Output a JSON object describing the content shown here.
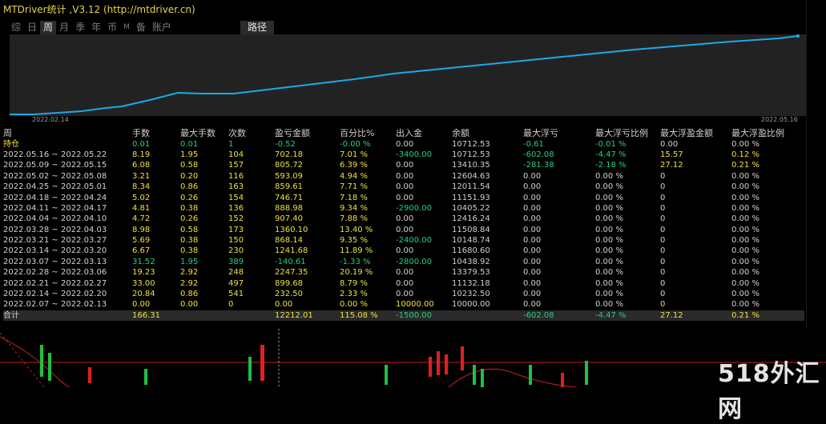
{
  "window": {
    "title": "MTDriver统计 ,V3.12 (http://mtdriver.cn)"
  },
  "tabs": [
    {
      "label": "综",
      "active": false
    },
    {
      "label": "日",
      "active": false
    },
    {
      "label": "周",
      "active": true
    },
    {
      "label": "月",
      "active": false
    },
    {
      "label": "季",
      "active": false
    },
    {
      "label": "年",
      "active": false
    },
    {
      "label": "币",
      "active": false
    },
    {
      "label": "M",
      "active": false
    },
    {
      "label": "备",
      "active": false
    },
    {
      "label": "账户",
      "active": false
    }
  ],
  "path_tab": "路径",
  "equity_chart": {
    "start_date": "2022.02.14",
    "end_date": "2022.05.16",
    "line_color": "#1ea8e8",
    "background": "#222222"
  },
  "table": {
    "headers": [
      "周",
      "手数",
      "最大手数",
      "次数",
      "盈亏金额",
      "百分比%",
      "出入金",
      "余额",
      "最大浮亏",
      "最大浮亏比例",
      "最大浮盈金额",
      "最大浮盈比例"
    ],
    "rows": [
      [
        "持仓",
        "0.01",
        "0.01",
        "1",
        "-0.52",
        "-0.00 %",
        "0.00",
        "10712.53",
        "-0.61",
        "-0.01 %",
        "0.00",
        "0.00 %"
      ],
      [
        "2022.05.16 ~ 2022.05.22",
        "8.19",
        "1.95",
        "104",
        "702.18",
        "7.01 %",
        "-3400.00",
        "10712.53",
        "-602.08",
        "-4.47 %",
        "15.57",
        "0.12 %"
      ],
      [
        "2022.05.09 ~ 2022.05.15",
        "6.08",
        "0.58",
        "157",
        "805.72",
        "6.39 %",
        "0.00",
        "13410.35",
        "-281.38",
        "-2.18 %",
        "27.12",
        "0.21 %"
      ],
      [
        "2022.05.02 ~ 2022.05.08",
        "3.21",
        "0.20",
        "116",
        "593.09",
        "4.94 %",
        "0.00",
        "12604.63",
        "0.00",
        "0.00 %",
        "0",
        "0.00 %"
      ],
      [
        "2022.04.25 ~ 2022.05.01",
        "8.34",
        "0.86",
        "163",
        "859.61",
        "7.71 %",
        "0.00",
        "12011.54",
        "0.00",
        "0.00 %",
        "0",
        "0.00 %"
      ],
      [
        "2022.04.18 ~ 2022.04.24",
        "5.02",
        "0.26",
        "154",
        "746.71",
        "7.18 %",
        "0.00",
        "11151.93",
        "0.00",
        "0.00 %",
        "0",
        "0.00 %"
      ],
      [
        "2022.04.11 ~ 2022.04.17",
        "4.81",
        "0.38",
        "136",
        "888.98",
        "9.34 %",
        "-2900.00",
        "10405.22",
        "0.00",
        "0.00 %",
        "0",
        "0.00 %"
      ],
      [
        "2022.04.04 ~ 2022.04.10",
        "4.72",
        "0.26",
        "152",
        "907.40",
        "7.88 %",
        "0.00",
        "12416.24",
        "0.00",
        "0.00 %",
        "0",
        "0.00 %"
      ],
      [
        "2022.03.28 ~ 2022.04.03",
        "8.98",
        "0.58",
        "173",
        "1360.10",
        "13.40 %",
        "0.00",
        "11508.84",
        "0.00",
        "0.00 %",
        "0",
        "0.00 %"
      ],
      [
        "2022.03.21 ~ 2022.03.27",
        "5.69",
        "0.38",
        "150",
        "868.14",
        "9.35 %",
        "-2400.00",
        "10148.74",
        "0.00",
        "0.00 %",
        "0",
        "0.00 %"
      ],
      [
        "2022.03.14 ~ 2022.03.20",
        "6.67",
        "0.38",
        "230",
        "1241.68",
        "11.89 %",
        "0.00",
        "11680.60",
        "0.00",
        "0.00 %",
        "0",
        "0.00 %"
      ],
      [
        "2022.03.07 ~ 2022.03.13",
        "31.52",
        "1.95",
        "389",
        "-140.61",
        "-1.33 %",
        "-2800.00",
        "10438.92",
        "0.00",
        "0.00 %",
        "0",
        "0.00 %"
      ],
      [
        "2022.02.28 ~ 2022.03.06",
        "19.23",
        "2.92",
        "248",
        "2247.35",
        "20.19 %",
        "0.00",
        "13379.53",
        "0.00",
        "0.00 %",
        "0",
        "0.00 %"
      ],
      [
        "2022.02.21 ~ 2022.02.27",
        "33.00",
        "2.92",
        "497",
        "899.68",
        "8.79 %",
        "0.00",
        "11132.18",
        "0.00",
        "0.00 %",
        "0",
        "0.00 %"
      ],
      [
        "2022.02.14 ~ 2022.02.20",
        "20.84",
        "0.86",
        "541",
        "232.50",
        "2.33 %",
        "0.00",
        "10232.50",
        "0.00",
        "0.00 %",
        "0",
        "0.00 %"
      ],
      [
        "2022.02.07 ~ 2022.02.13",
        "0.00",
        "0.00",
        "0",
        "0.00",
        "0.00 %",
        "10000.00",
        "10000.00",
        "0.00",
        "0.00 %",
        "0",
        "0.00 %"
      ]
    ],
    "total": [
      "合计",
      "166.31",
      "",
      "",
      "12212.01",
      "115.08 %",
      "-1500.00",
      "",
      "-602.08",
      "-4.47 %",
      "27.12",
      "0.21 %"
    ]
  },
  "colors": {
    "yellow": "#f0e040",
    "green": "#22d080",
    "white": "#d2d2d2",
    "accent_line": "#1ea8e8"
  },
  "watermark": "518外汇网"
}
